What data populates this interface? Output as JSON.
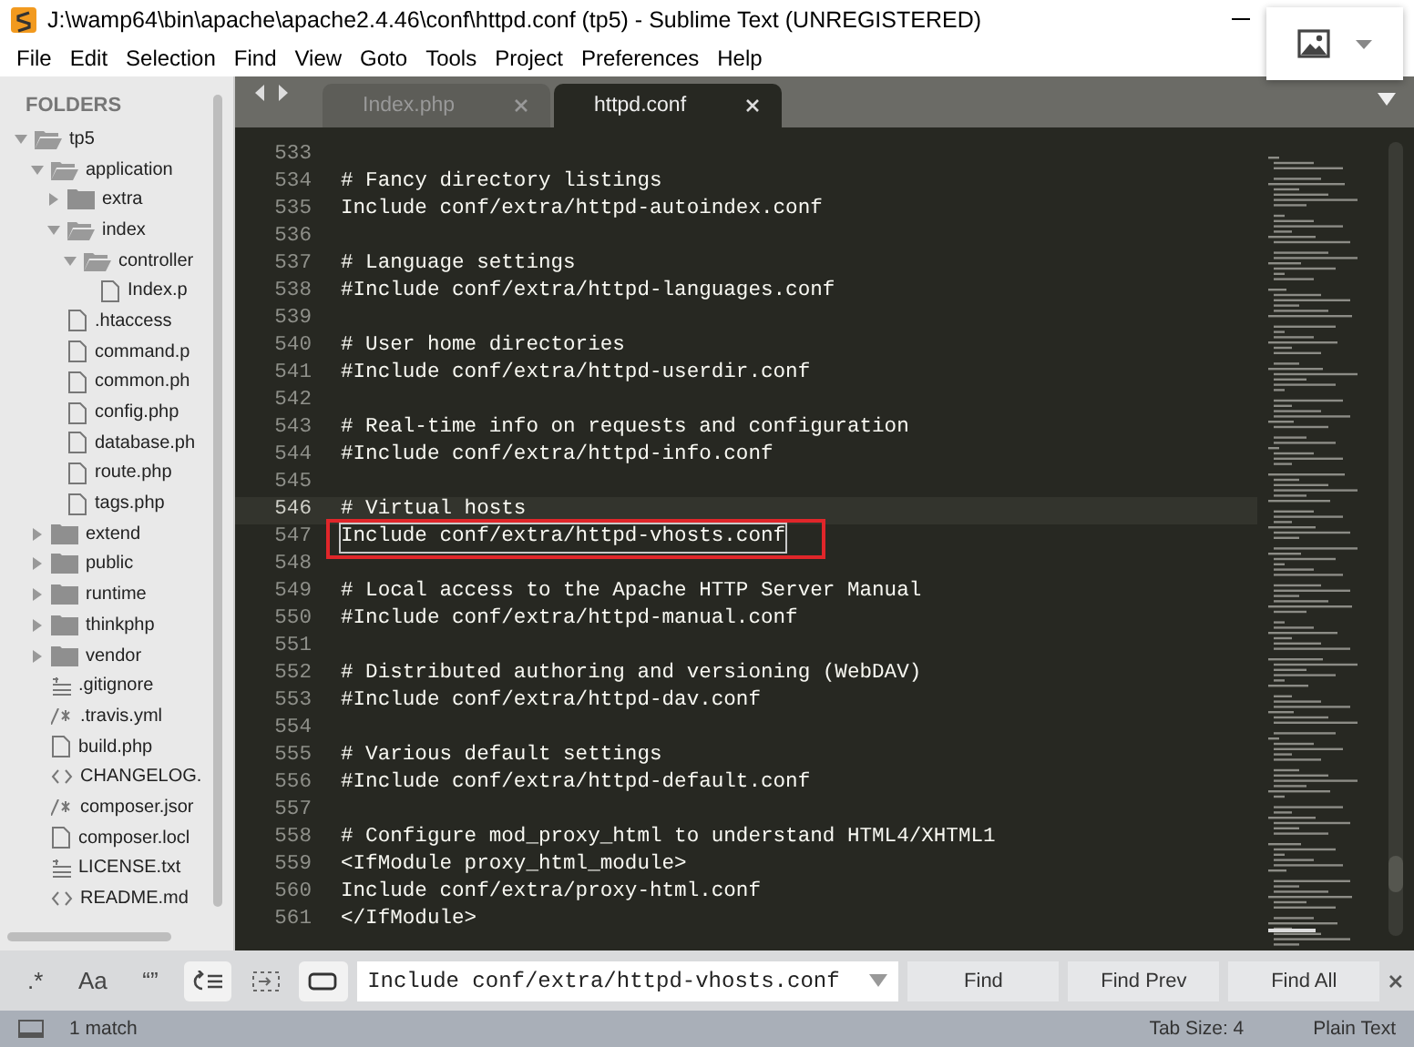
{
  "window": {
    "title": "J:\\wamp64\\bin\\apache\\apache2.4.46\\conf\\httpd.conf (tp5) - Sublime Text (UNREGISTERED)"
  },
  "menu": [
    "File",
    "Edit",
    "Selection",
    "Find",
    "View",
    "Goto",
    "Tools",
    "Project",
    "Preferences",
    "Help"
  ],
  "sidebar": {
    "heading": "FOLDERS",
    "items": [
      {
        "label": "tp5",
        "kind": "folder",
        "expanded": true,
        "children": [
          {
            "label": "application",
            "kind": "folder",
            "expanded": true,
            "children": [
              {
                "label": "extra",
                "kind": "folder",
                "expanded": false
              },
              {
                "label": "index",
                "kind": "folder",
                "expanded": true,
                "children": [
                  {
                    "label": "controller",
                    "kind": "folder",
                    "expanded": true,
                    "children": [
                      {
                        "label": "Index.p",
                        "kind": "file"
                      }
                    ]
                  }
                ]
              },
              {
                "label": ".htaccess",
                "kind": "file"
              },
              {
                "label": "command.p",
                "kind": "file"
              },
              {
                "label": "common.ph",
                "kind": "file"
              },
              {
                "label": "config.php",
                "kind": "file"
              },
              {
                "label": "database.ph",
                "kind": "file"
              },
              {
                "label": "route.php",
                "kind": "file"
              },
              {
                "label": "tags.php",
                "kind": "file"
              }
            ]
          },
          {
            "label": "extend",
            "kind": "folder",
            "expanded": false
          },
          {
            "label": "public",
            "kind": "folder",
            "expanded": false
          },
          {
            "label": "runtime",
            "kind": "folder",
            "expanded": false
          },
          {
            "label": "thinkphp",
            "kind": "folder",
            "expanded": false
          },
          {
            "label": "vendor",
            "kind": "folder",
            "expanded": false
          },
          {
            "label": ".gitignore",
            "kind": "lines"
          },
          {
            "label": ".travis.yml",
            "kind": "comment"
          },
          {
            "label": "build.php",
            "kind": "file"
          },
          {
            "label": "CHANGELOG.",
            "kind": "markup"
          },
          {
            "label": "composer.jsor",
            "kind": "comment"
          },
          {
            "label": "composer.locl",
            "kind": "file"
          },
          {
            "label": "LICENSE.txt",
            "kind": "lines"
          },
          {
            "label": "README.md",
            "kind": "markup"
          }
        ]
      }
    ]
  },
  "tabs": [
    {
      "label": "Index.php",
      "selected": false
    },
    {
      "label": "httpd.conf",
      "selected": true
    }
  ],
  "lines": [
    {
      "number": "533",
      "current": false,
      "match": false
    },
    {
      "number": "534",
      "text": "# Fancy directory listings",
      "current": false,
      "match": false
    },
    {
      "number": "535",
      "text": "Include conf/extra/httpd-autoindex.conf",
      "current": false,
      "match": false
    },
    {
      "number": "536",
      "current": false,
      "match": false
    },
    {
      "number": "537",
      "text": "# Language settings",
      "current": false,
      "match": false
    },
    {
      "number": "538",
      "text": "#Include conf/extra/httpd-languages.conf",
      "current": false,
      "match": false
    },
    {
      "number": "539",
      "current": false,
      "match": false
    },
    {
      "number": "540",
      "text": "# User home directories",
      "current": false,
      "match": false
    },
    {
      "number": "541",
      "text": "#Include conf/extra/httpd-userdir.conf",
      "current": false,
      "match": false
    },
    {
      "number": "542",
      "current": false,
      "match": false
    },
    {
      "number": "543",
      "text": "# Real-time info on requests and configuration",
      "current": false,
      "match": false
    },
    {
      "number": "544",
      "text": "#Include conf/extra/httpd-info.conf",
      "current": false,
      "match": false
    },
    {
      "number": "545",
      "current": false,
      "match": false
    },
    {
      "number": "546",
      "text": "# Virtual hosts",
      "current": true,
      "match": false
    },
    {
      "number": "547",
      "text": "Include conf/extra/httpd-vhosts.conf",
      "current": false,
      "match": true
    },
    {
      "number": "548",
      "current": false,
      "match": false
    },
    {
      "number": "549",
      "text": "# Local access to the Apache HTTP Server Manual",
      "current": false,
      "match": false
    },
    {
      "number": "550",
      "text": "#Include conf/extra/httpd-manual.conf",
      "current": false,
      "match": false
    },
    {
      "number": "551",
      "current": false,
      "match": false
    },
    {
      "number": "552",
      "text": "# Distributed authoring and versioning (WebDAV)",
      "current": false,
      "match": false
    },
    {
      "number": "553",
      "text": "#Include conf/extra/httpd-dav.conf",
      "current": false,
      "match": false
    },
    {
      "number": "554",
      "current": false,
      "match": false
    },
    {
      "number": "555",
      "text": "# Various default settings",
      "current": false,
      "match": false
    },
    {
      "number": "556",
      "text": "#Include conf/extra/httpd-default.conf",
      "current": false,
      "match": false
    },
    {
      "number": "557",
      "current": false,
      "match": false
    },
    {
      "number": "558",
      "text": "# Configure mod_proxy_html to understand HTML4/XHTML1",
      "current": false,
      "match": false
    },
    {
      "number": "559",
      "text": "<IfModule proxy_html_module>",
      "current": false,
      "match": false
    },
    {
      "number": "560",
      "text": "Include conf/extra/proxy-html.conf",
      "current": false,
      "match": false
    },
    {
      "number": "561",
      "text": "</IfModule>",
      "current": false,
      "match": false
    }
  ],
  "find": {
    "toggles": [
      {
        "kind": "regex",
        "label": ".*",
        "on": false
      },
      {
        "kind": "case",
        "label": "Aa",
        "on": false
      },
      {
        "kind": "word",
        "label": "“”",
        "on": false
      },
      {
        "kind": "wrap",
        "on": true
      },
      {
        "kind": "selection",
        "on": false
      },
      {
        "kind": "highlight",
        "on": true
      }
    ],
    "value": "Include conf/extra/httpd-vhosts.conf",
    "buttons": [
      "Find",
      "Find Prev",
      "Find All"
    ]
  },
  "status_bar": {
    "message": "1 match",
    "tab_size": "Tab Size: 4",
    "syntax": "Plain Text"
  }
}
